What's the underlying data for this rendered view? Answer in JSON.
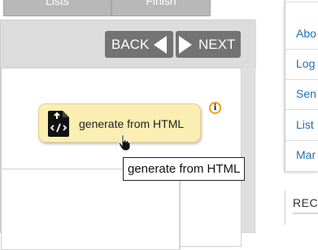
{
  "tabs": [
    {
      "label": "Lists"
    },
    {
      "label": "Finish"
    }
  ],
  "nav": {
    "back_label": "BACK",
    "next_label": "NEXT"
  },
  "generate": {
    "label": "generate from HTML",
    "tooltip": "generate from HTML",
    "icon": "html-file-icon"
  },
  "info": {
    "glyph": "i"
  },
  "sidebar": {
    "items": [
      {
        "label": "Abo"
      },
      {
        "label": "Log"
      },
      {
        "label": "Sen"
      },
      {
        "label": "List"
      },
      {
        "label": "Mar"
      }
    ],
    "section_heading": "REC"
  },
  "colors": {
    "button_bg": "#737373",
    "generate_bg": "#fbeeb2",
    "link": "#1e70b8",
    "info_ring": "#f29c11"
  }
}
